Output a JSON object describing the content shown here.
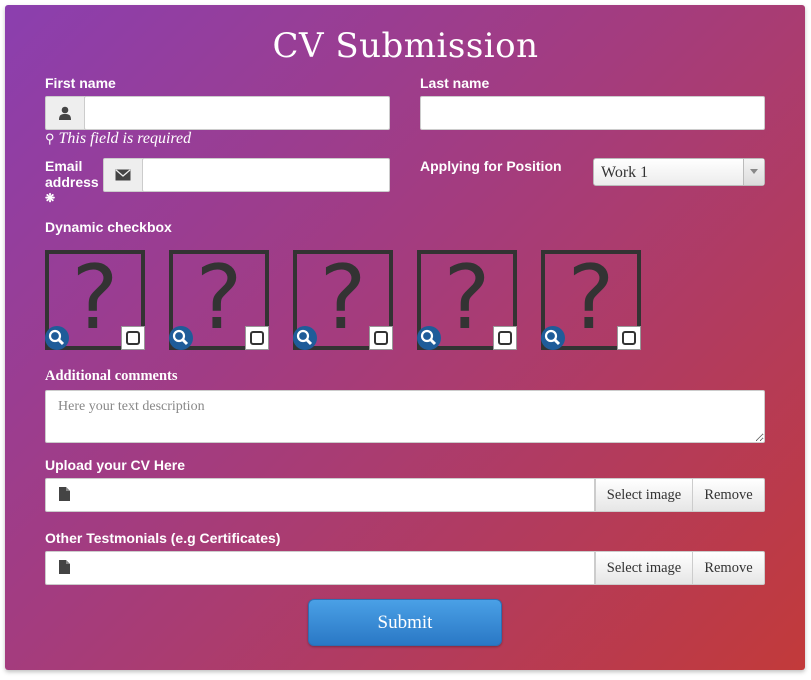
{
  "form": {
    "title": "CV Submission",
    "first_name": {
      "label": "First name",
      "value": "",
      "hint": "This field is required"
    },
    "last_name": {
      "label": "Last name",
      "value": ""
    },
    "email": {
      "label_line1": "Email",
      "label_line2": "address",
      "required_mark": "❋",
      "value": ""
    },
    "position": {
      "label": "Applying for Position",
      "selected": "Work 1"
    },
    "dynamic_checkbox": {
      "label": "Dynamic checkbox",
      "items": [
        {
          "placeholder": "?",
          "checked": false
        },
        {
          "placeholder": "?",
          "checked": false
        },
        {
          "placeholder": "?",
          "checked": false
        },
        {
          "placeholder": "?",
          "checked": false
        },
        {
          "placeholder": "?",
          "checked": false
        }
      ]
    },
    "comments": {
      "label": "Additional comments",
      "placeholder": "Here your text description"
    },
    "cv_upload": {
      "label": "Upload your CV Here",
      "select_label": "Select image",
      "remove_label": "Remove"
    },
    "testimonials_upload": {
      "label": "Other Testmonials (e.g Certificates)",
      "select_label": "Select image",
      "remove_label": "Remove"
    },
    "submit_label": "Submit"
  },
  "icons": {
    "first_name_addon": "user-icon",
    "email_addon": "envelope-icon",
    "hint": "lightbulb-icon",
    "tile_zoom": "magnifier-icon",
    "upload": "file-icon",
    "select_arrow": "chevron-down-icon"
  },
  "colors": {
    "background_start": "#8b3faf",
    "background_end": "#c23a3a",
    "submit": "#2a78c5",
    "zoom_badge": "#1f5c99"
  }
}
